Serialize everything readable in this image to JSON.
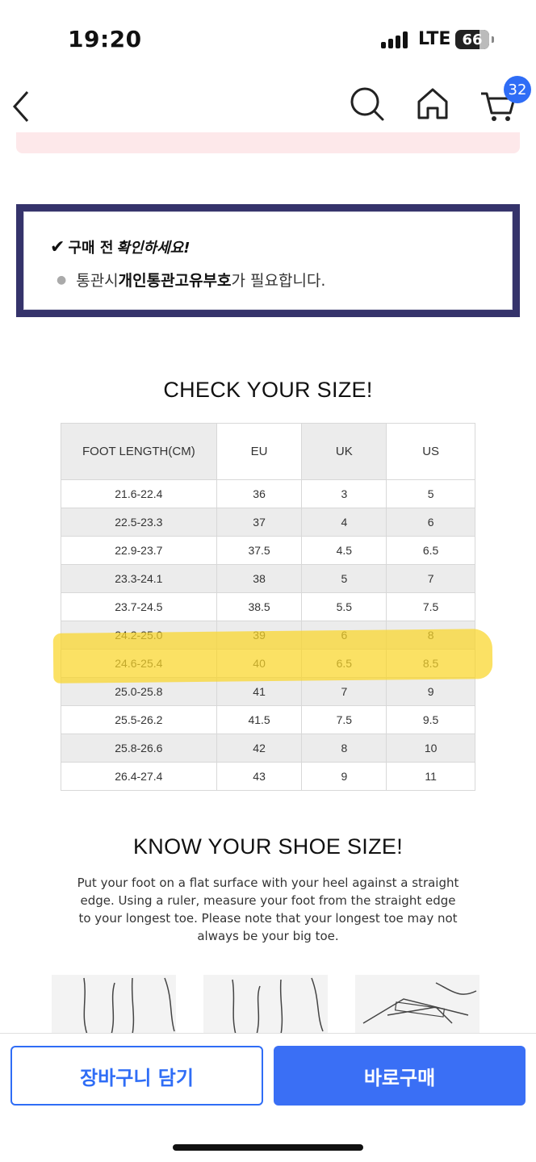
{
  "status_bar": {
    "time": "19:20",
    "network": "LTE",
    "battery": "66"
  },
  "nav": {
    "cart_count": "32"
  },
  "notice": {
    "title_prefix": "구매 전",
    "title_emphasis": "확인하세요!",
    "body_prefix": "통관시 ",
    "body_bold": "개인통관고유부호",
    "body_suffix": "가 필요합니다."
  },
  "size_chart": {
    "title": "CHECK YOUR SIZE!",
    "headers": [
      "FOOT LENGTH(CM)",
      "EU",
      "UK",
      "US"
    ],
    "rows": [
      [
        "21.6-22.4",
        "36",
        "3",
        "5"
      ],
      [
        "22.5-23.3",
        "37",
        "4",
        "6"
      ],
      [
        "22.9-23.7",
        "37.5",
        "4.5",
        "6.5"
      ],
      [
        "23.3-24.1",
        "38",
        "5",
        "7"
      ],
      [
        "23.7-24.5",
        "38.5",
        "5.5",
        "7.5"
      ],
      [
        "24.2-25.0",
        "39",
        "6",
        "8"
      ],
      [
        "24.6-25.4",
        "40",
        "6.5",
        "8.5"
      ],
      [
        "25.0-25.8",
        "41",
        "7",
        "9"
      ],
      [
        "25.5-26.2",
        "41.5",
        "7.5",
        "9.5"
      ],
      [
        "25.8-26.6",
        "42",
        "8",
        "10"
      ],
      [
        "26.4-27.4",
        "43",
        "9",
        "11"
      ]
    ]
  },
  "know_size": {
    "title": "KNOW YOUR SHOE SIZE!",
    "text": "Put your foot on a flat surface with your heel against a straight edge. Using a ruler, measure your foot from the straight edge to your longest toe. Please note that your longest toe may not always be your big toe."
  },
  "bottom_bar": {
    "cart_label": "장바구니 담기",
    "buy_label": "바로구매"
  },
  "colors": {
    "accent": "#2f6df6",
    "notice_border": "#35336b",
    "highlight": "#fad628"
  }
}
